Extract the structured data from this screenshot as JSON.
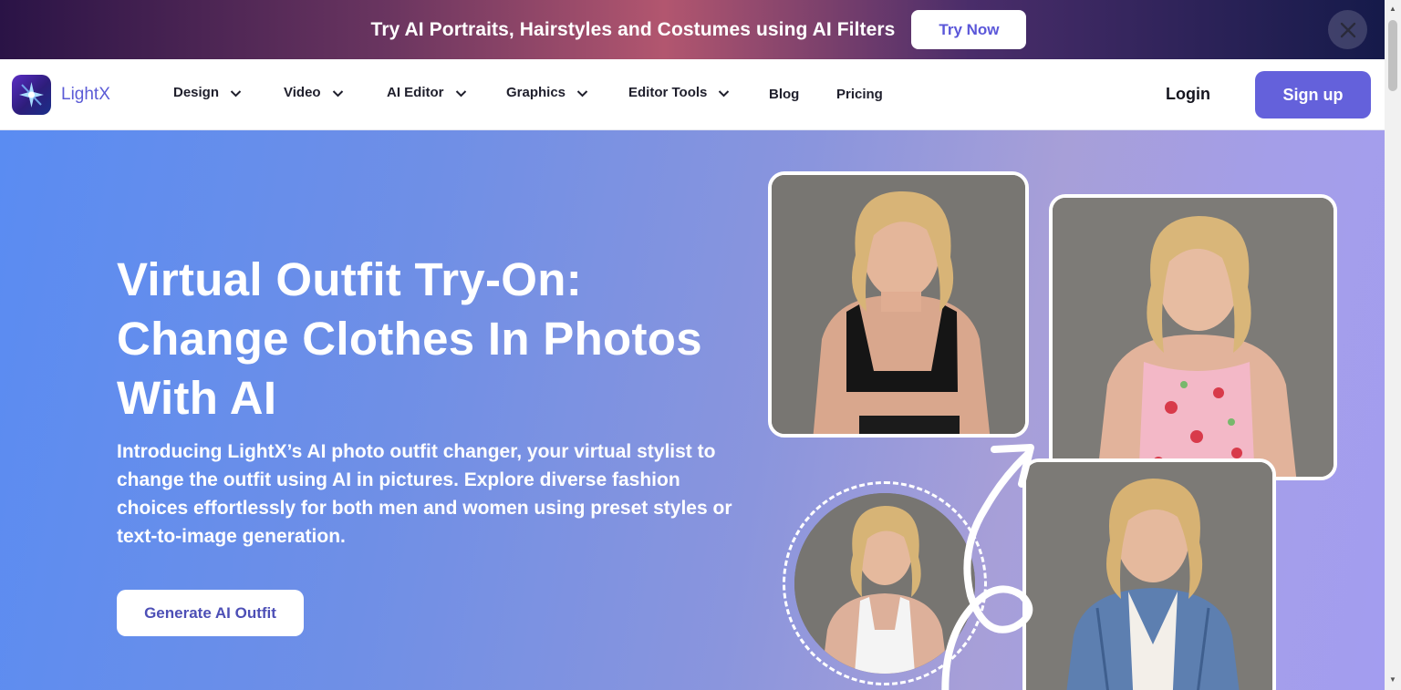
{
  "promo": {
    "text": "Try AI Portraits, Hairstyles and Costumes using AI Filters",
    "button_label": "Try Now",
    "close_icon": "close-icon"
  },
  "nav": {
    "logo_text": "LightX",
    "items": [
      {
        "label": "Design",
        "has_dropdown": true
      },
      {
        "label": "Video",
        "has_dropdown": true
      },
      {
        "label": "AI Editor",
        "has_dropdown": true
      },
      {
        "label": "Graphics",
        "has_dropdown": true
      },
      {
        "label": "Editor Tools",
        "has_dropdown": true
      },
      {
        "label": "Blog",
        "has_dropdown": false
      },
      {
        "label": "Pricing",
        "has_dropdown": false
      }
    ],
    "login_label": "Login",
    "signup_label": "Sign up"
  },
  "hero": {
    "title_line1": "Virtual Outfit Try-On:",
    "title_line2": "Change Clothes In Photos",
    "title_line3": "With AI",
    "description": "Introducing LightX’s AI photo outfit changer, your virtual stylist to change the outfit using AI in pictures. Explore diverse fashion choices effortlessly for both men and women using preset styles or text-to-image generation.",
    "cta_label": "Generate AI Outfit",
    "images": [
      {
        "name": "outfit-black-crop-top",
        "outfit_color": "#151515"
      },
      {
        "name": "outfit-floral-dress",
        "outfit_color": "#f3b8c7"
      },
      {
        "name": "outfit-denim-jacket",
        "outfit_color": "#5d7fb0"
      },
      {
        "name": "original-white-tank",
        "outfit_color": "#f4f4f4"
      }
    ]
  },
  "colors": {
    "brand": "#6461db",
    "accent_text": "#5b57d9",
    "hero_start": "#5a8cf2",
    "hero_end": "#a39df0"
  }
}
